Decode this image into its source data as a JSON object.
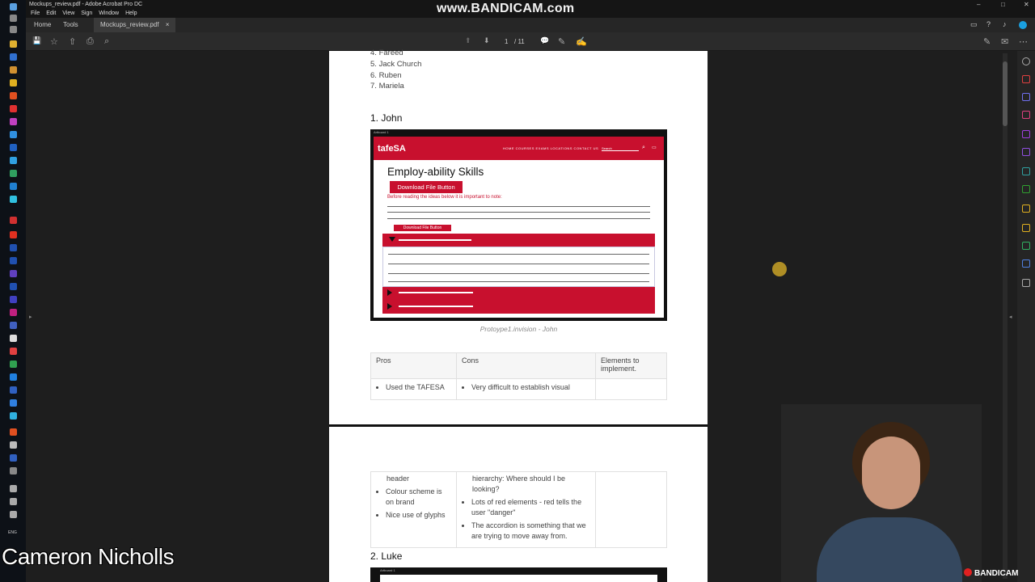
{
  "window": {
    "title": "Mockups_review.pdf - Adobe Acrobat Pro DC",
    "controls": [
      "–",
      "□",
      "✕"
    ]
  },
  "watermark": "www.BANDICAM.com",
  "menu": [
    "File",
    "Edit",
    "View",
    "Sign",
    "Window",
    "Help"
  ],
  "tabs": {
    "home": "Home",
    "tools": "Tools",
    "doc": "Mockups_review.pdf",
    "close": "×"
  },
  "toolbar": {
    "page_current": "1",
    "page_total": "/ 11"
  },
  "icons": {
    "save": "💾",
    "star": "☆",
    "upload": "⇧",
    "print": "⎙",
    "search": "⌕",
    "prev_page": "⬆",
    "next_page": "⬇",
    "comment": "💬",
    "pen": "✎",
    "sign": "✍"
  },
  "page1": {
    "list": [
      {
        "num": "4.",
        "name": "Fareed"
      },
      {
        "num": "5.",
        "name": "Jack Church"
      },
      {
        "num": "6.",
        "name": "Ruben"
      },
      {
        "num": "7.",
        "name": "Mariela"
      }
    ],
    "heading": "1. John",
    "mockup": {
      "artboard": "Artboard 1",
      "logo": "tafeSA",
      "nav_links": "HOME  COURSES  EXAMS  LOCATIONS  CONTACT US",
      "search": "Search",
      "title": "Employ-ability Skills",
      "download_btn": "Download File Button",
      "note": "Before reading the ideas below it is important to note:",
      "download_btn_small": "Download File Button"
    },
    "caption": "Protoype1.invision - John",
    "table": {
      "headers": [
        "Pros",
        "Cons",
        "Elements to implement."
      ],
      "row1": {
        "pros": "Used the TAFESA",
        "cons": "Very difficult to establish visual"
      }
    }
  },
  "page2": {
    "pros": [
      "header",
      "Colour scheme is on brand",
      "Nice use of glyphs"
    ],
    "cons": [
      "hierarchy: Where should I be looking?",
      "Lots of red elements - red tells the user \"danger\"",
      "The accordion is something that we are trying to move away from."
    ],
    "heading": "2. Luke",
    "artboard": "Artboard 1"
  },
  "presenter_name": "Cameron Nicholls",
  "recorder_logo": "BANDICAM",
  "taskbar_lang": "ENG"
}
